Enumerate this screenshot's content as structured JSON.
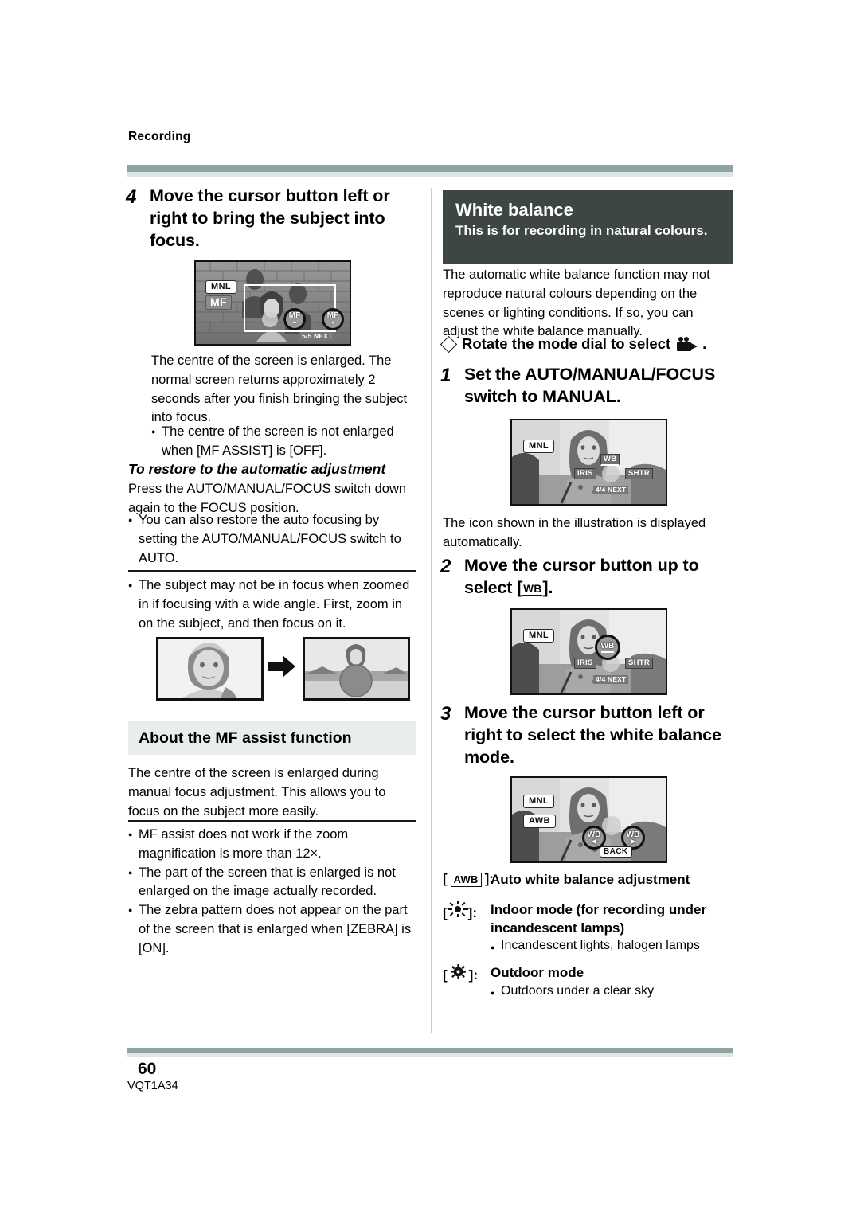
{
  "running_head": "Recording",
  "footer": {
    "page_number": "60",
    "doc_code": "VQT1A34"
  },
  "left_column": {
    "step4": {
      "number": "4",
      "title": "Move the cursor button left or right to bring the subject into focus."
    },
    "illustration_mf": {
      "tag_mnl": "MNL",
      "tag_mf": "MF",
      "btn_left": "MF",
      "btn_right": "MF",
      "btn_left_sign": "–",
      "btn_right_sign": "+",
      "exit_label": "5/5 NEXT"
    },
    "body1": "The centre of the screen is enlarged. The normal screen returns approximately 2 seconds after you finish bringing the subject into focus.",
    "bullets1": [
      "The centre of the screen is not enlarged when [MF ASSIST] is [OFF]."
    ],
    "restore_heading": "To restore to the automatic adjustment",
    "body2": "Press the AUTO/MANUAL/FOCUS switch down again to the FOCUS position.",
    "bullets2": [
      "You can also restore the auto focusing by setting the AUTO/MANUAL/FOCUS switch to AUTO."
    ],
    "bullets3": [
      "The subject may not be in focus when zoomed in if focusing with a wide angle. First, zoom in on the subject, and then focus on it."
    ],
    "section_header": "About the MF assist function",
    "body3": "The centre of the screen is enlarged during manual focus adjustment. This allows you to focus on the subject more easily.",
    "bullets4": [
      "MF assist does not work if the zoom magnification is more than 12×.",
      "The part of the screen that is enlarged is not enlarged on the image actually recorded.",
      "The zebra pattern does not appear on the part of the screen that is enlarged when [ZEBRA] is [ON]."
    ]
  },
  "right_column": {
    "header_title": "White balance",
    "header_subtitle": "This is for recording in natural colours.",
    "intro": "The automatic white balance function may not reproduce natural colours depending on the scenes or lighting conditions. If so, you can adjust the white balance manually.",
    "mode_dial_line_before": "Rotate the mode dial to select",
    "mode_dial_line_after": ".",
    "step1": {
      "number": "1",
      "title": "Set the AUTO/MANUAL/FOCUS switch to MANUAL."
    },
    "illustration1": {
      "tag_mnl": "MNL",
      "btn_wb": "WB",
      "btn_iris": "IRIS",
      "btn_shtr": "SHTR",
      "exit_label": "4/4 NEXT"
    },
    "note1": "The icon shown in the illustration is displayed automatically.",
    "step2": {
      "number": "2",
      "title_before": "Move the cursor button up to select [",
      "title_icon": "WB",
      "title_after": "]."
    },
    "illustration2": {
      "tag_mnl": "MNL",
      "btn_wb": "WB",
      "btn_iris": "IRIS",
      "btn_shtr": "SHTR",
      "exit_label": "4/4 NEXT"
    },
    "step3": {
      "number": "3",
      "title": "Move the cursor button left or right to select the white balance mode."
    },
    "illustration3": {
      "tag_mnl": "MNL",
      "tag_awb": "AWB",
      "btn_wb_left": "WB",
      "btn_wb_right": "WB",
      "btn_back": "BACK"
    },
    "modes": [
      {
        "icon": "awb-chip",
        "key_label": "AWB",
        "description": "Auto white balance adjustment",
        "sub": ""
      },
      {
        "icon": "indoor-lamp-icon",
        "key_label": "",
        "description": "Indoor mode (for recording under incandescent lamps)",
        "sub": "Incandescent lights, halogen lamps"
      },
      {
        "icon": "outdoor-sun-icon",
        "key_label": "",
        "description": "Outdoor mode",
        "sub": "Outdoors under a clear sky"
      }
    ]
  },
  "colors": {
    "rule_sage": "#8ea4a3",
    "rule_sage_light": "#dfe6e5",
    "dark_header_bg": "#3d4545",
    "section_header_bg": "#eaeded"
  }
}
